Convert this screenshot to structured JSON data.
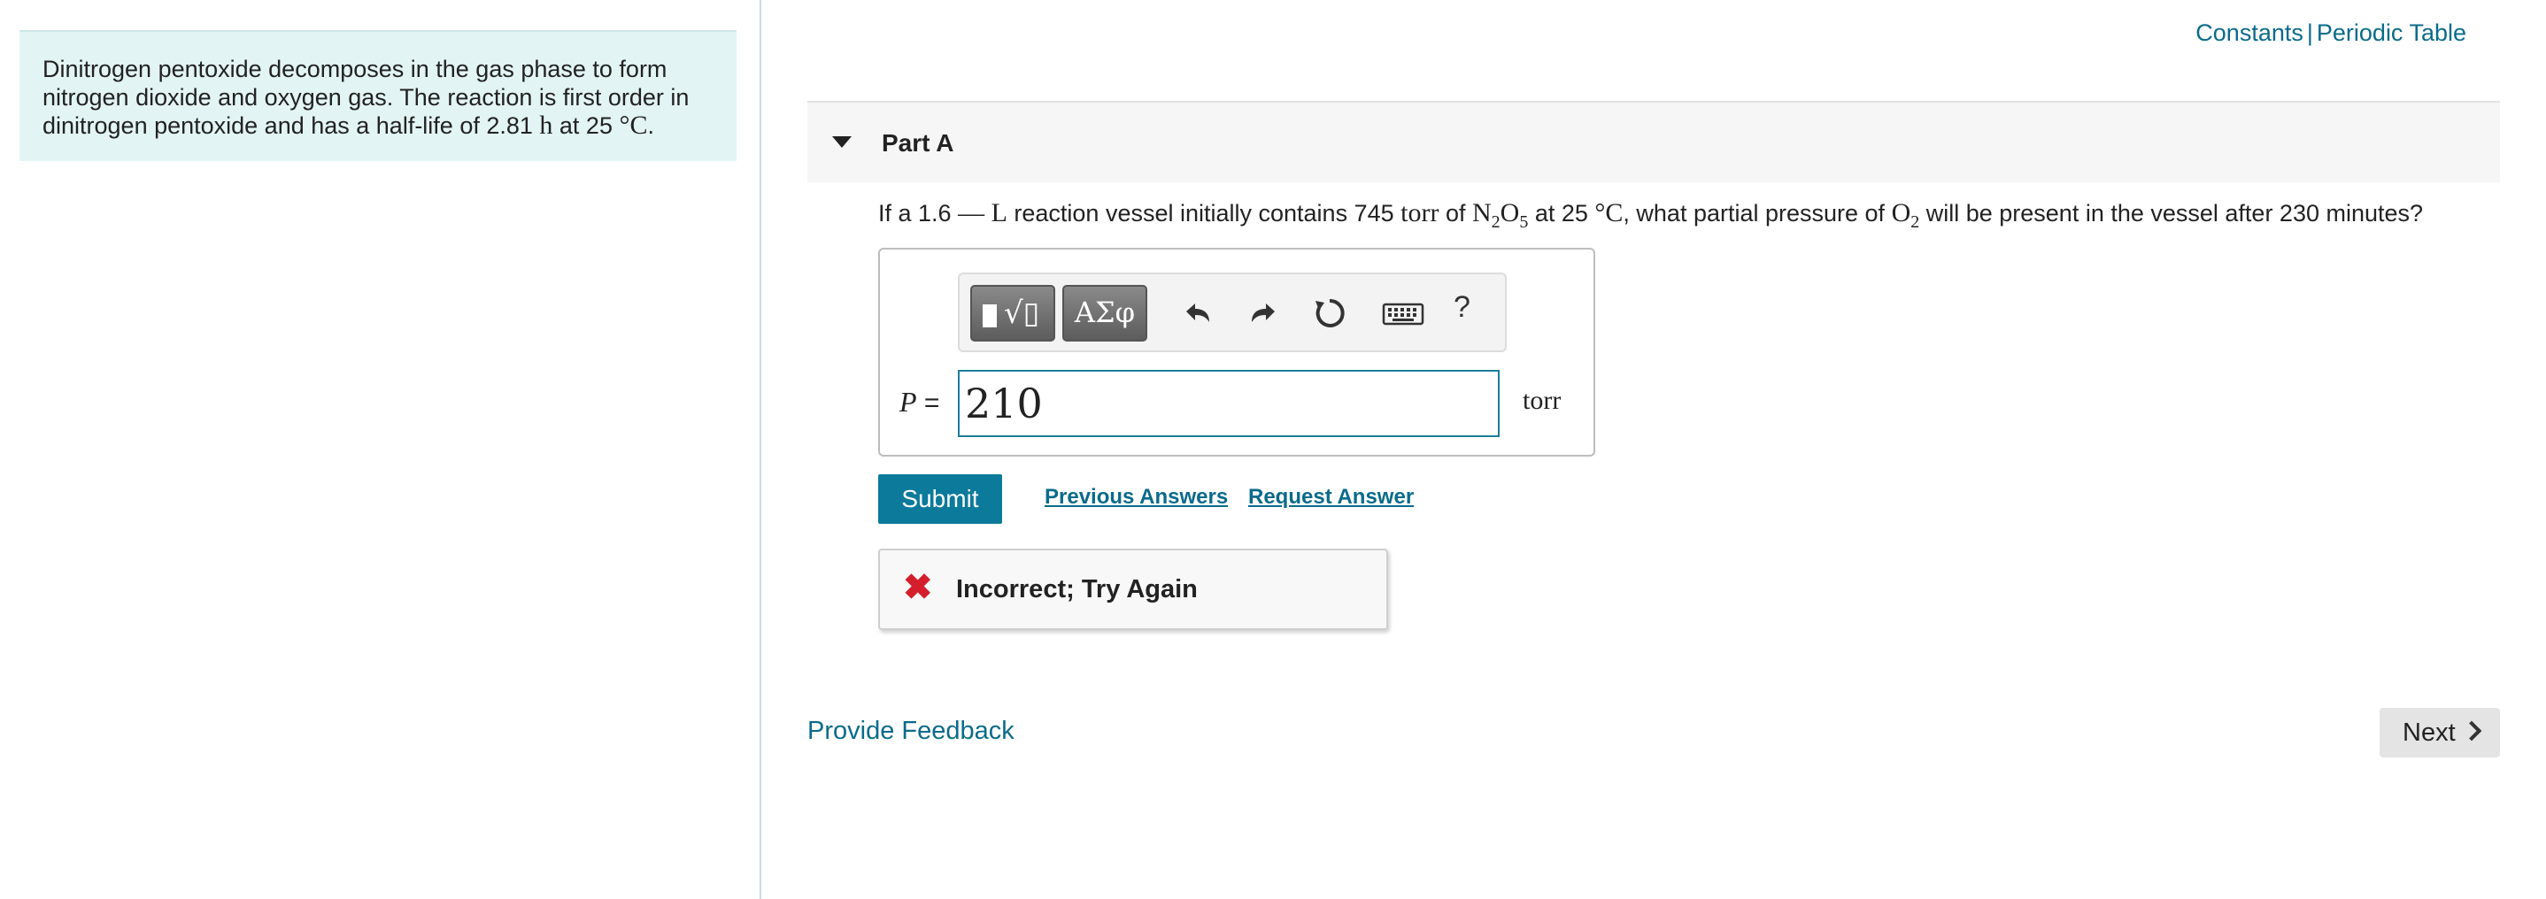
{
  "intro": {
    "text_before": "Dinitrogen pentoxide decomposes in the gas phase to form nitrogen dioxide and oxygen gas. The reaction is first order in dinitrogen pentoxide and has a half-life of 2.81 ",
    "unit_h": "h",
    "text_mid": " at 25 ",
    "unit_c": "°C",
    "text_end": "."
  },
  "top_links": {
    "constants": "Constants",
    "separator": "|",
    "periodic_table": "Periodic Table"
  },
  "part": {
    "title": "Part A"
  },
  "question": {
    "t1": "If a 1.6 ",
    "m1": "— L",
    "t2": " reaction vessel initially contains 745 ",
    "m2": "torr",
    "t3": " of ",
    "n": "N",
    "n_sub": "2",
    "o": "O",
    "o_sub": "5",
    "t4": " at 25 ",
    "m3": "°C",
    "t5": ", what partial pressure of ",
    "o2": "O",
    "o2_sub": "2",
    "t6": " will be present in the vessel after 230 minutes?"
  },
  "toolbar": {
    "template_radical": "√▯",
    "greek": "ΑΣφ",
    "help": "?"
  },
  "answer": {
    "var": "P",
    "equals": " = ",
    "value": "210",
    "unit": "torr"
  },
  "actions": {
    "submit": "Submit",
    "previous_answers": "Previous Answers",
    "request_answer": "Request Answer"
  },
  "feedback": {
    "icon": "✖",
    "message": "Incorrect; Try Again"
  },
  "footer": {
    "provide_feedback": "Provide Feedback",
    "next": "Next"
  }
}
